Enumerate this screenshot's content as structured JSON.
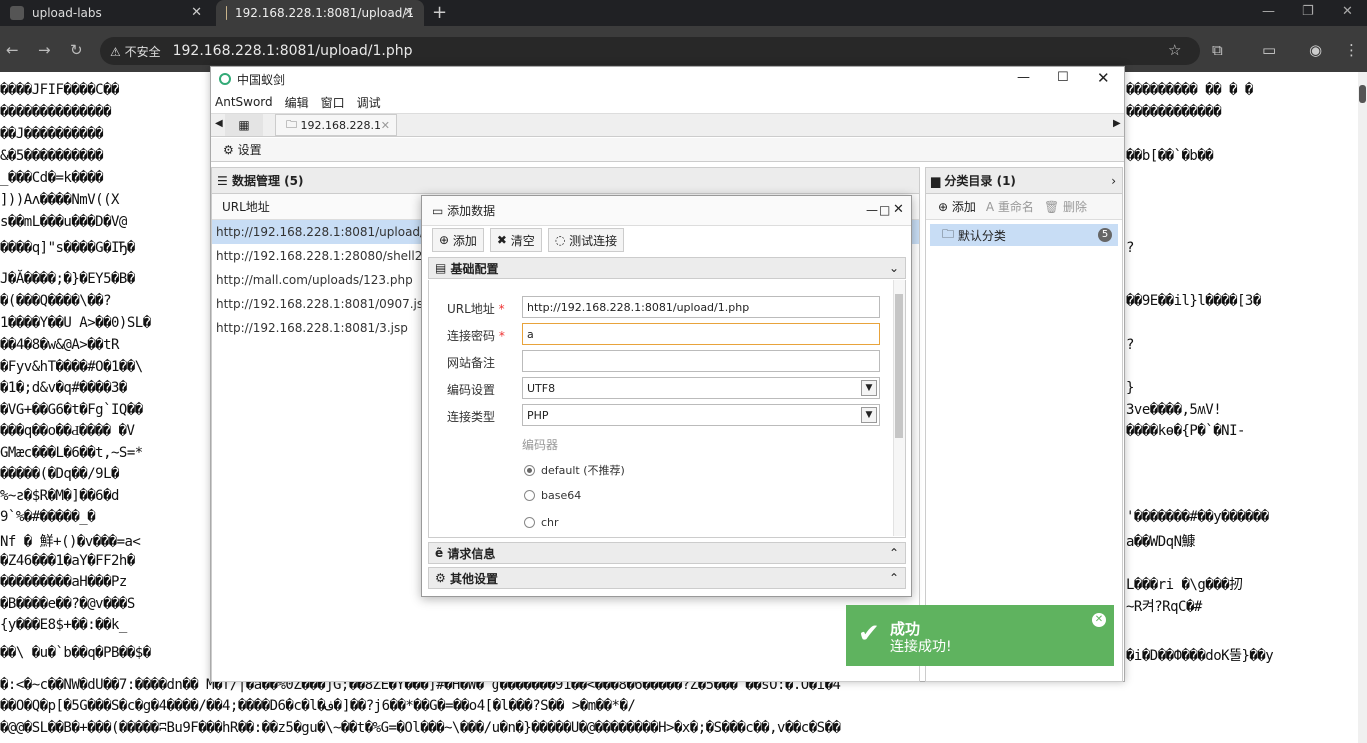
{
  "browser": {
    "tabs": [
      {
        "label": "upload-labs"
      },
      {
        "label": "192.168.228.1:8081/upload/1"
      }
    ],
    "security_label": "不安全",
    "url": "192.168.228.1:8081/upload/1.php"
  },
  "page_garbage": [
    "����JFIF����C��",
    "��������������",
    "��J����������",
    "&�5����������",
    "_���Cd�=k����",
    "]))Aʌ����NmV((X",
    "s��mL���u���D�V@",
    "����q]\"s����G�IЂ�",
    "J�Ă����;�}�EY5�B�",
    "�(���Q����\\��?",
    "1����Y��U A>��0)SL�",
    "��4�8�w&@A>��tR",
    "�Fyv&hT����#O�1��\\",
    "�1�;d&v�q#����3�",
    "�VG+��G6�t�Fg`IQ��",
    "���q��o��Ԁ���� �V",
    "GMæc���L�6��t,~S=*",
    "�����(�Dq��/9L�",
    "%~ƨ�$R�M�]��6�d",
    "9`%�#�����_�",
    "Nf � 鮮+()�v���=a<",
    "�Z46���1�aY�FF2h�",
    "���������aH���Pz",
    "�B����e��?�@v���S",
    "{y���E8$+��:��k_",
    "��\\ �u�`b��q�PB��$�",
    "�:<�~c��NW�dU��7:����dn�� M�f/|�a��%0Z���jG;��8ZE�Y���]#�H�W� ̉ɠ�������91��<���8�6�����?Z�5��� ��sO:�.O�i�4",
    "��O�Q�p[�5G���S�c�g�4����/��4;����D6�c�l�ف�]��?j6��*��G�=��o4[�l���?S�� >�m��*�/",
    "�@@�SL��B�+���(�����ʭBu9F���hR��:��z5�gu�\\~��t�%G=�Ol���~\\���/u�n�}�����U�@��������H>�x�;�S���c��,v��c�S��"
  ],
  "page_garbage_right": [
    "���������  ��  �  �",
    "������������",
    "��b[��`�b��",
    "?",
    "��9E��il}l����[3�",
    "?",
    "}",
    "3ve����,5ʍV!",
    "����kɵ�{P�`�NI-",
    "'�������#��y������",
    "a��WDqN鱇",
    "L���ri �\\g���扨",
    "~R켜?RqC�#",
    "�i�D��Ф���doK뚤}��y"
  ],
  "antsword": {
    "title": "中国蚁剑",
    "menu": [
      "AntSword",
      "编辑",
      "窗口",
      "调试"
    ],
    "tab_label": "192.168.228.1",
    "settings_label": "设置",
    "data_panel": {
      "title": "数据管理 (5)",
      "column": "URL地址",
      "rows": [
        "http://192.168.228.1:8081/upload/shell.",
        "http://192.168.228.1:28080/shell2.php",
        "http://mall.com/uploads/123.php",
        "http://192.168.228.1:8081/0907.jsp",
        "http://192.168.228.1:8081/3.jsp"
      ]
    },
    "category_panel": {
      "title": "分类目录 (1)",
      "add": "添加",
      "rename": "重命名",
      "delete": "删除",
      "default_category": "默认分类",
      "count": "5"
    }
  },
  "dialog": {
    "title": "添加数据",
    "toolbar": {
      "add": "添加",
      "clear": "清空",
      "test": "测试连接"
    },
    "section_basic": "基础配置",
    "fields": {
      "url_label": "URL地址",
      "url_value": "http://192.168.228.1:8081/upload/1.php",
      "password_label": "连接密码",
      "password_value": "a",
      "note_label": "网站备注",
      "note_value": "",
      "encoding_label": "编码设置",
      "encoding_value": "UTF8",
      "type_label": "连接类型",
      "type_value": "PHP",
      "encoder_label": "编码器",
      "encoders": [
        "default (不推荐)",
        "base64",
        "chr"
      ]
    },
    "section_request": "请求信息",
    "section_other": "其他设置"
  },
  "toast": {
    "title": "成功",
    "message": "连接成功!"
  }
}
